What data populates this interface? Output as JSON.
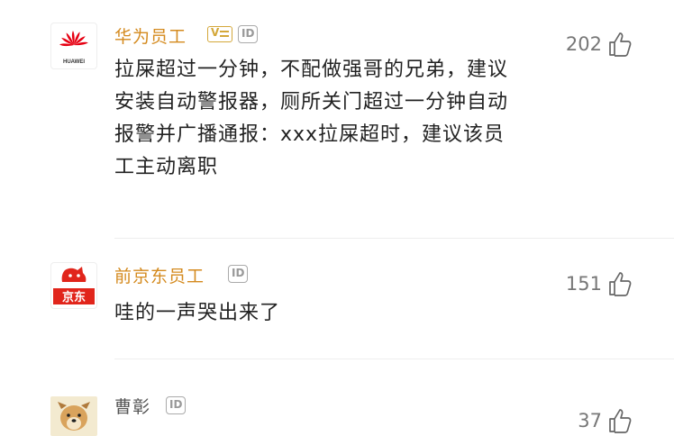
{
  "comments": [
    {
      "user": "华为员工",
      "badges": [
        "V",
        "ID"
      ],
      "text": "拉屎超过一分钟，不配做强哥的兄弟，建议安装自动警报器，厕所关门超过一分钟自动报警并广播通报：xxx拉屎超时，建议该员工主动离职",
      "likes": "202",
      "avatar_label": "HUAWEI"
    },
    {
      "user": "前京东员工",
      "badges": [
        "ID"
      ],
      "text": "哇的一声哭出来了",
      "likes": "151",
      "avatar_label": "京东"
    },
    {
      "user": "曹彰",
      "badges": [
        "ID"
      ],
      "text": "",
      "likes": "37",
      "avatar_label": ""
    }
  ],
  "colors": {
    "username": "#d48a1e",
    "huawei_red": "#e60012",
    "jd_red": "#e1251b"
  },
  "icons": {
    "like": "thumb-up-icon",
    "huawei": "huawei-logo",
    "jd": "jd-logo",
    "dog": "dog-avatar-icon"
  }
}
